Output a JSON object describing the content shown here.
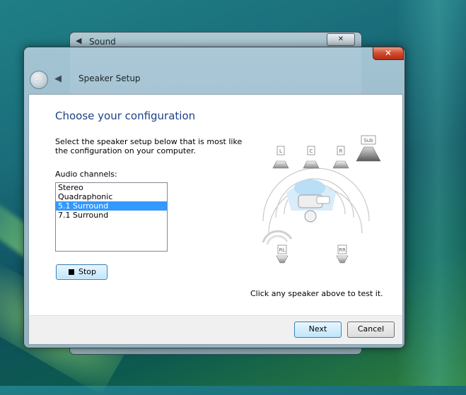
{
  "background_window": {
    "title": "Sound",
    "close_label": "✕"
  },
  "dialog": {
    "title": "Speaker Setup",
    "close_label": "✕",
    "heading": "Choose your configuration",
    "description": "Select the speaker setup below that is most like the configuration on your computer.",
    "channels_label": "Audio channels:",
    "channels": [
      "Stereo",
      "Quadraphonic",
      "5.1 Surround",
      "7.1 Surround"
    ],
    "selected_channel": "5.1 Surround",
    "stop_label": "Stop",
    "speakers": {
      "left": "L",
      "center": "C",
      "right": "R",
      "sub": "Sub",
      "rear_left": "RL",
      "rear_right": "RR"
    },
    "test_hint": "Click any speaker above to test it.",
    "next_label": "Next",
    "cancel_label": "Cancel"
  },
  "colors": {
    "heading": "#1e3f87",
    "selection": "#3399ff",
    "close_red": "#c8402a"
  }
}
